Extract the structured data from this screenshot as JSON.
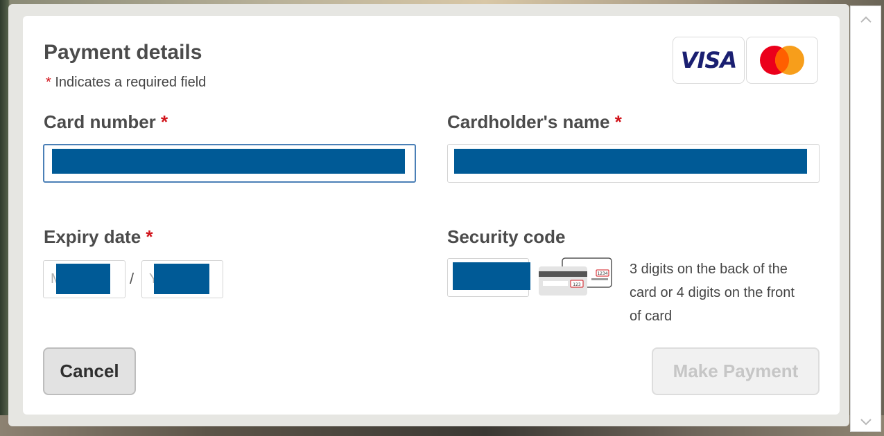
{
  "modal": {
    "title": "Payment details",
    "required_star": "*",
    "required_note": "Indicates a required field"
  },
  "cards": {
    "visa_label": "VISA",
    "mastercard_colors": [
      "#eb001b",
      "#f79e1b"
    ]
  },
  "fields": {
    "card_number": {
      "label": "Card number",
      "required": "*"
    },
    "cardholder_name": {
      "label": "Cardholder's name",
      "required": "*"
    },
    "expiry_date": {
      "label": "Expiry date",
      "required": "*",
      "month_placeholder": "M",
      "year_placeholder": "Y",
      "separator": "/"
    },
    "security_code": {
      "label": "Security code",
      "help": "3 digits on the back of the card or 4 digits on the front of card",
      "icon_front_digits": "1234",
      "icon_back_digits": "123"
    }
  },
  "buttons": {
    "cancel": "Cancel",
    "pay": "Make Payment"
  },
  "colors": {
    "required_star": "#d1141b",
    "focus_border": "#4a7fb6",
    "redaction": "#005a96"
  }
}
